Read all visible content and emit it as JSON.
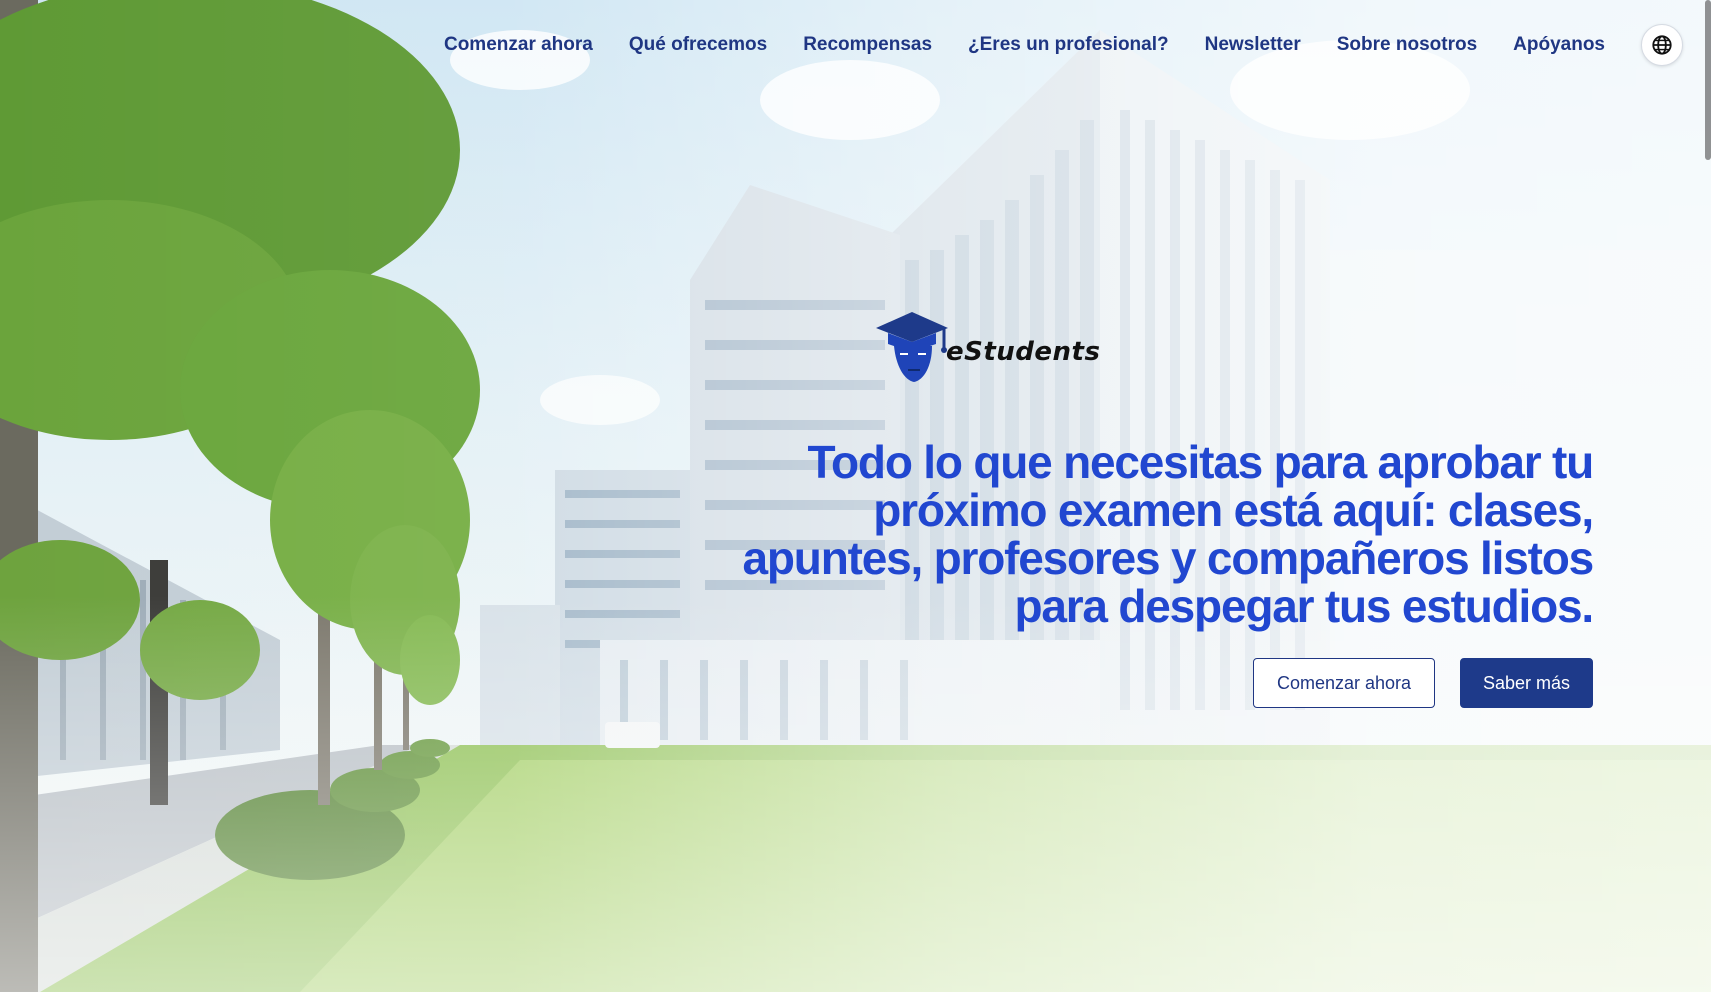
{
  "nav": {
    "items": [
      {
        "label": "Comenzar ahora"
      },
      {
        "label": "Qué ofrecemos"
      },
      {
        "label": "Recompensas"
      },
      {
        "label": "¿Eres un profesional?"
      },
      {
        "label": "Newsletter"
      },
      {
        "label": "Sobre nosotros"
      },
      {
        "label": "Apóyanos"
      }
    ],
    "language_icon": "globe-icon"
  },
  "hero": {
    "logo_text": "eStudents",
    "logo_icon": "graduation-cap-student-icon",
    "headline": "Todo lo que necesitas para aprobar tu próximo examen está aquí: clases, apuntes, profesores y compañeros listos para despegar tus estudios.",
    "primary_button": "Comenzar ahora",
    "secondary_button": "Saber más"
  },
  "colors": {
    "brand_dark": "#1e3a8a",
    "headline": "#2147d0",
    "nav_text": "#1f3683"
  }
}
